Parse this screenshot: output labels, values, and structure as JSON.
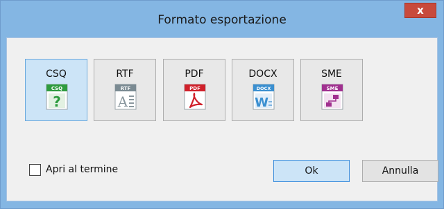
{
  "window": {
    "title": "Formato esportazione",
    "close_glyph": "x"
  },
  "formats": [
    {
      "label": "CSQ",
      "badge": "CSQ",
      "color": "#2e9b3e",
      "glyph": "?",
      "icon": "csq-file-icon",
      "selected": true
    },
    {
      "label": "RTF",
      "badge": "RTF",
      "color": "#7a8a92",
      "glyph": "A",
      "icon": "rtf-file-icon",
      "selected": false
    },
    {
      "label": "PDF",
      "badge": "PDF",
      "color": "#d0202a",
      "glyph": "",
      "icon": "pdf-file-icon",
      "selected": false
    },
    {
      "label": "DOCX",
      "badge": "DOCX",
      "color": "#3a8fd0",
      "glyph": "W",
      "icon": "docx-file-icon",
      "selected": false
    },
    {
      "label": "SME",
      "badge": "SME",
      "color": "#a0308f",
      "glyph": "",
      "icon": "sme-file-icon",
      "selected": false
    }
  ],
  "options": {
    "open_when_done": "Apri al termine",
    "open_when_done_checked": false
  },
  "buttons": {
    "ok": "Ok",
    "cancel": "Annulla"
  }
}
